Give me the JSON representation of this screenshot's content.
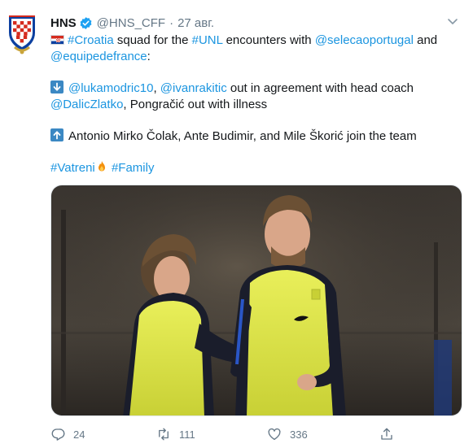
{
  "tweet": {
    "display_name": "HNS",
    "handle": "@HNS_CFF",
    "dot": "·",
    "time": "27 авг.",
    "line1": {
      "hashtag_croatia": "#Croatia",
      "t1": " squad for the ",
      "hashtag_unl": "#UNL",
      "t2": " encounters with ",
      "mention_portugal": "@selecaoportugal",
      "t3": " and"
    },
    "line2": {
      "mention_france": "@equipedefrance",
      "t1": ":"
    },
    "line3": {
      "mention_modric": "@lukamodric10",
      "t1": ", ",
      "mention_rakitic": "@ivanrakitic",
      "t2": " out in agreement with head coach"
    },
    "line4": {
      "mention_dalic": "@DalicZlatko",
      "t1": ", Pongračić out with illness"
    },
    "line5": {
      "t1": "Antonio Mirko Čolak, Ante Budimir, and Mile Škorić join the team"
    },
    "line6": {
      "hashtag_vatreni": "#Vatreni",
      "hashtag_family": "#Family"
    }
  },
  "actions": {
    "replies": "24",
    "retweets": "111",
    "likes": "336"
  },
  "icons": {
    "avatar": "hns-crest-logo",
    "verified": "verified-badge-icon",
    "caret": "chevron-down-icon",
    "flag": "croatia-flag-emoji",
    "down": "down-arrow-emoji",
    "up": "up-arrow-emoji",
    "fire": "fire-emoji",
    "reply": "reply-icon",
    "retweet": "retweet-icon",
    "like": "heart-icon",
    "share": "share-icon"
  },
  "colors": {
    "link": "#1b95e0",
    "text": "#14171a",
    "muted": "#657786",
    "verified": "#1da1f2"
  }
}
